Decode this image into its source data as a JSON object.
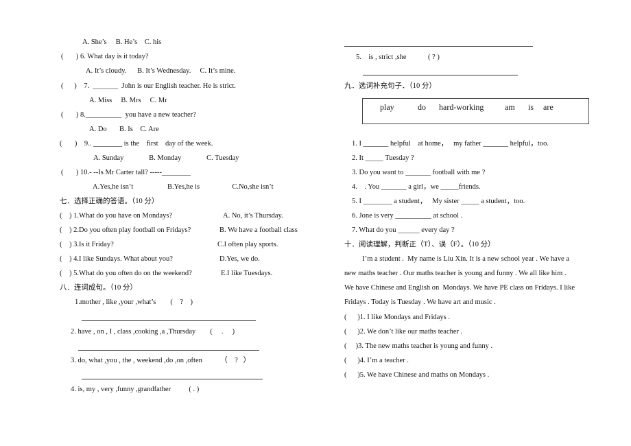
{
  "left": {
    "q5_options": "A. She’s     B. He’s    C. his",
    "q6": "(       ) 6. What day is it today?",
    "q6_options": "A. It’s cloudy.      B. It’s Wednesday.     C. It’s mine.",
    "q7": "(      )    7.  _______  John is our English teacher. He is strict.",
    "q7_options": "A. Miss     B. Mrs     C. Mr",
    "q8": "(       ) 8.__________  you have a new teacher?",
    "q8_options": "A. Do       B. Is    C. Are",
    "q9": "(       )    9.. ________ is the    first    day of the week.",
    "q9_options": "A. Sunday              B. Monday              C. Tuesday",
    "q10": "(       ) 10.- --Is Mr Carter tall? -----________",
    "q10_options": "A.Yes,he isn’t                   B.Yes,he is                  C.No,she isn’t",
    "sec7_title": "七．选择正确的答语。（10 分）",
    "sec7": [
      {
        "q": "(    ) 1.What do you have on Mondays?",
        "a": "A. No, it’s Thursday."
      },
      {
        "q": "(    ) 2.Do you often play football on Fridays?",
        "a": "B. We have a football class"
      },
      {
        "q": "(    ) 3.Is it Friday?",
        "a": "C.I often play sports."
      },
      {
        "q": "(    ) 4.I like Sundays. What about you?",
        "a": "D.Yes, we do."
      },
      {
        "q": "(    ) 5.What do you often do on the weekend?",
        "a": "E.I like Tuesdays."
      }
    ],
    "sec8_title": "八．连词成句。（10 分）",
    "sec8": [
      "1.mother , like ,your ,what’s        (    ?    )",
      "2. have , on , I , class ,cooking ,a ,Thursday        (     .     )",
      "3. do, what ,you , the , weekend ,do ,on ,often          （    ?   ）",
      "4. is, my , very ,funny ,grandfather          ( . )"
    ]
  },
  "right": {
    "sec8_q5": "5.    is , strict ,she            ( ? )",
    "sec9_title": "九．选词补充句子．（10 分）",
    "word_box": [
      "play",
      "do",
      "hard-working",
      "am",
      "is",
      "are"
    ],
    "sec9": [
      "1. I _______ helpful    at home，   my father _______ helpful，too.",
      "2. It _____ Tuesday ?",
      "3. Do you want to _______ football with me ?",
      "4.    . You _______ a girl，we _____friends.",
      "5. I ________ a student，   My sister _____ a student，too.",
      "6. Jone is very __________ at school .",
      "7. What do you ______ every day ?"
    ],
    "sec10_title": "十．阅读理解，判断正（T）、误（F）。（10 分）",
    "passage": [
      "          I’m a student .  My name is Liu Xin. It is a new school year . We have a",
      "new maths teacher . Our maths teacher is young and funny . We all like him .",
      "We have Chinese and English on  Mondays. We have PE class on Fridays. I like",
      "Fridays . Today is Tuesday . We have art and music ."
    ],
    "sec10": [
      "(      )1. I like Mondays and Fridays .",
      "(      )2. We don’t like our maths teacher .",
      "(     )3. The new maths teacher is young and funny .",
      "(      )4. I’m a teacher .",
      "(      )5. We have Chinese and maths on Mondays ."
    ]
  }
}
